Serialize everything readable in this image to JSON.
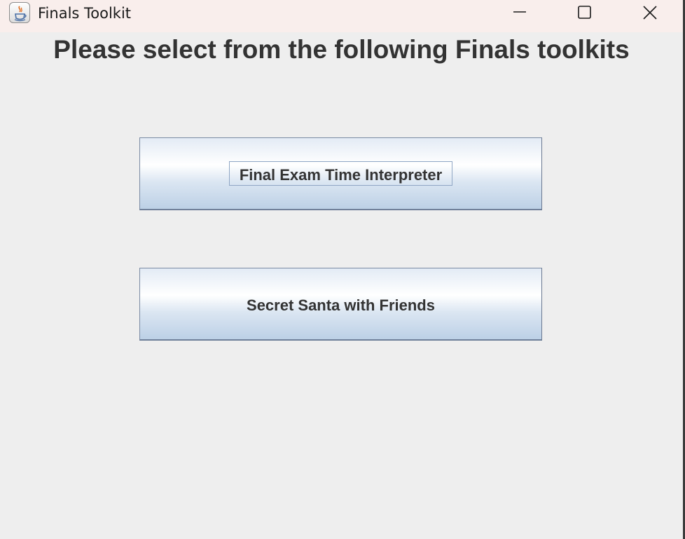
{
  "window": {
    "title": "Finals Toolkit",
    "app_icon": "java-cup-icon",
    "controls": {
      "minimize_icon": "minimize-icon",
      "maximize_icon": "maximize-icon",
      "close_icon": "close-icon"
    }
  },
  "main": {
    "heading": "Please select from the following Finals toolkits",
    "buttons": [
      {
        "label": "Final Exam Time Interpreter",
        "focused": true
      },
      {
        "label": "Secret Santa with Friends",
        "focused": false
      }
    ]
  },
  "colors": {
    "titlebar_bg": "#f9eeec",
    "content_bg": "#eeeeee",
    "text": "#333333",
    "button_border": "#7a8aa3",
    "button_gradient_bottom": "#bcd0e6"
  }
}
